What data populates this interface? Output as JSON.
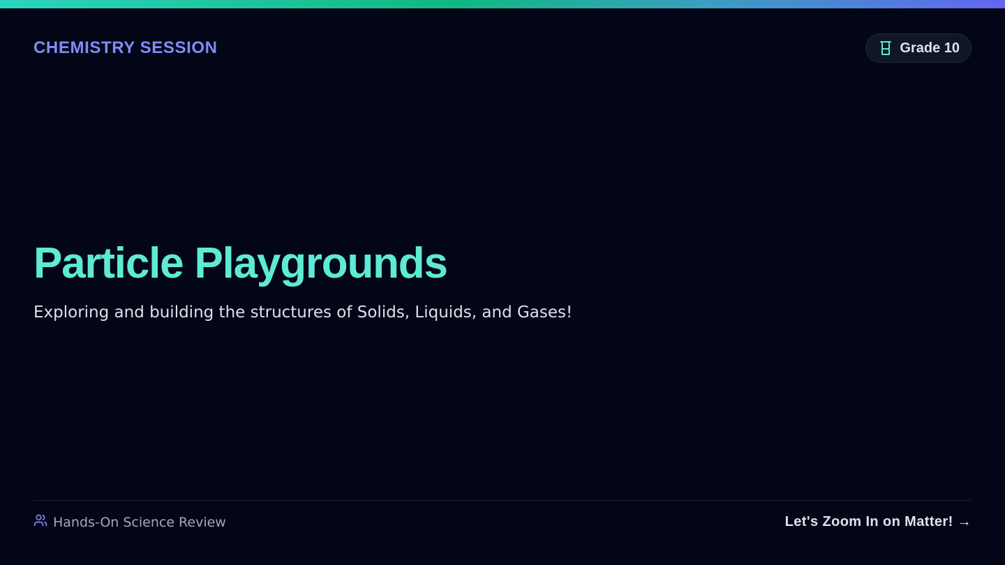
{
  "header": {
    "eyebrow": "CHEMISTRY SESSION",
    "badge": {
      "icon": "beaker-icon",
      "label": "Grade 10"
    }
  },
  "hero": {
    "title": "Particle Playgrounds",
    "subtitle": "Exploring and building the structures of Solids, Liquids, and Gases!"
  },
  "footer": {
    "left": {
      "icon": "users-icon",
      "label": "Hands-On Science Review"
    },
    "cta": "Let's Zoom In on Matter! →"
  },
  "colors": {
    "background": "#030616",
    "accent_teal": "#5eead4",
    "accent_indigo": "#818cf8",
    "text_light": "#dfe3ea",
    "text_muted": "#a3a9b6"
  }
}
